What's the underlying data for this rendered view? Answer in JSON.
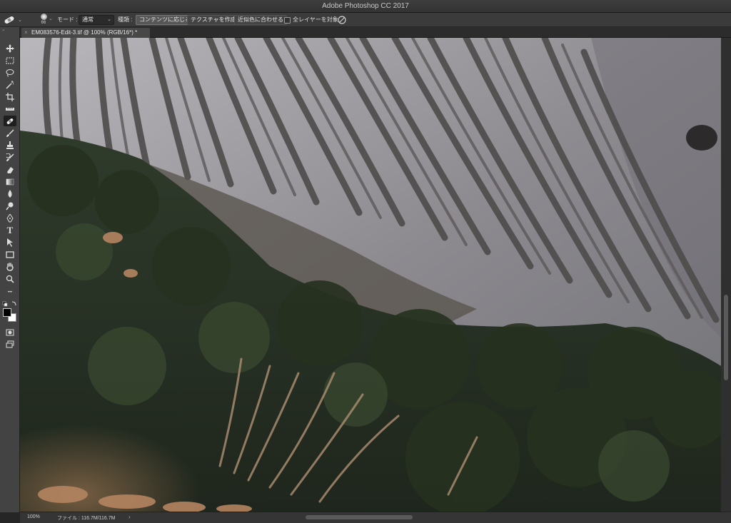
{
  "window": {
    "title": "Adobe Photoshop CC 2017"
  },
  "options_bar": {
    "brush_size": "66",
    "mode_label": "モード :",
    "mode_value": "通常",
    "type_label": "種類 :",
    "type_buttons": [
      "コンテンツに応じる",
      "テクスチャを作成",
      "近似色に合わせる"
    ],
    "active_type_index": 0,
    "sample_all_layers_label": "全レイヤーを対象",
    "sample_all_layers_checked": false
  },
  "document_tab": {
    "close_glyph": "×",
    "name": "EM083576-Edit-3.tif @ 100% (RGB/16*) *"
  },
  "toolbar": {
    "tools": [
      {
        "name": "move-tool-icon"
      },
      {
        "name": "marquee-tool-icon"
      },
      {
        "name": "lasso-tool-icon"
      },
      {
        "name": "magic-wand-tool-icon"
      },
      {
        "name": "crop-tool-icon"
      },
      {
        "name": "ruler-tool-icon"
      },
      {
        "name": "spot-healing-brush-tool-icon",
        "selected": true
      },
      {
        "name": "brush-tool-icon"
      },
      {
        "name": "clone-stamp-tool-icon"
      },
      {
        "name": "history-brush-tool-icon"
      },
      {
        "name": "eraser-tool-icon"
      },
      {
        "name": "gradient-tool-icon"
      },
      {
        "name": "blur-tool-icon"
      },
      {
        "name": "dodge-tool-icon"
      },
      {
        "name": "pen-tool-icon"
      },
      {
        "name": "type-tool-icon"
      },
      {
        "name": "path-selection-tool-icon"
      },
      {
        "name": "rectangle-tool-icon"
      },
      {
        "name": "hand-tool-icon"
      },
      {
        "name": "zoom-tool-icon"
      },
      {
        "name": "edit-toolbar-icon"
      }
    ],
    "type_tool_glyph": "T",
    "more_glyph": "•••",
    "foreground_color": "#000000",
    "background_color": "#ffffff"
  },
  "status_bar": {
    "zoom": "100%",
    "file_info": "ファイル : 116.7M/116.7M",
    "arrow": "›"
  }
}
